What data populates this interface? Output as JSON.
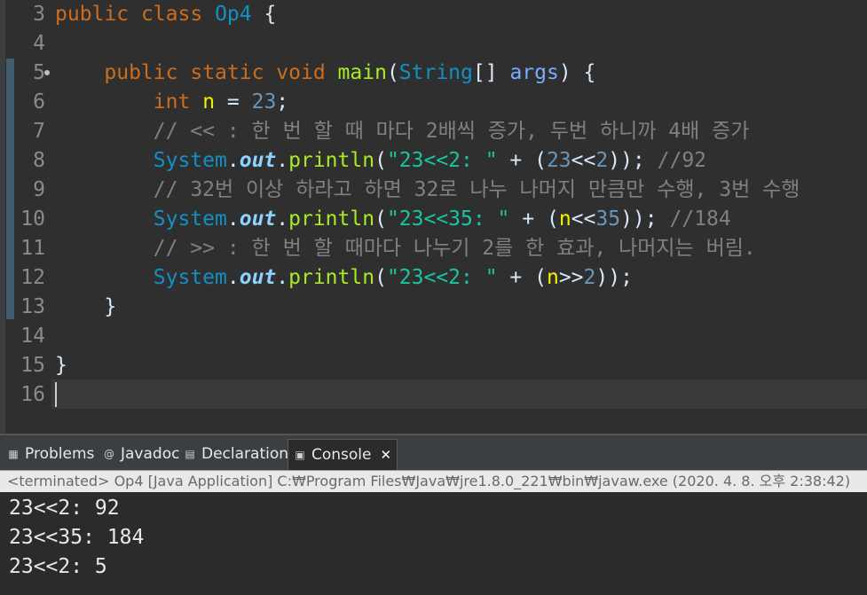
{
  "editor": {
    "lines": [
      {
        "n": "3",
        "segs": [
          [
            "kw",
            "public"
          ],
          [
            "p",
            " "
          ],
          [
            "kw",
            "class"
          ],
          [
            "p",
            " "
          ],
          [
            "ty",
            "Op4"
          ],
          [
            "p",
            " {"
          ]
        ]
      },
      {
        "n": "4",
        "segs": []
      },
      {
        "n": "5",
        "segs": [
          [
            "p",
            "    "
          ],
          [
            "kw",
            "public"
          ],
          [
            "p",
            " "
          ],
          [
            "kw",
            "static"
          ],
          [
            "p",
            " "
          ],
          [
            "kw",
            "void"
          ],
          [
            "p",
            " "
          ],
          [
            "fn",
            "main"
          ],
          [
            "p",
            "("
          ],
          [
            "ty",
            "String"
          ],
          [
            "p",
            "[] "
          ],
          [
            "va",
            "args"
          ],
          [
            "p",
            ") {"
          ]
        ]
      },
      {
        "n": "6",
        "segs": [
          [
            "p",
            "        "
          ],
          [
            "kw",
            "int"
          ],
          [
            "p",
            " "
          ],
          [
            "fl",
            "n"
          ],
          [
            "p",
            " = "
          ],
          [
            "nu",
            "23"
          ],
          [
            "p",
            ";"
          ]
        ]
      },
      {
        "n": "7",
        "segs": [
          [
            "p",
            "        "
          ],
          [
            "cm",
            "// << : 한 번 할 때 마다 2배씩 증가, 두번 하니까 4배 증가"
          ]
        ]
      },
      {
        "n": "8",
        "segs": [
          [
            "p",
            "        "
          ],
          [
            "ty",
            "System"
          ],
          [
            "p",
            "."
          ],
          [
            "sf",
            "out"
          ],
          [
            "p",
            "."
          ],
          [
            "fn",
            "println"
          ],
          [
            "p",
            "("
          ],
          [
            "st",
            "\"23<<2: \""
          ],
          [
            "p",
            " + ("
          ],
          [
            "nu",
            "23"
          ],
          [
            "p",
            "<<"
          ],
          [
            "nu",
            "2"
          ],
          [
            "p",
            "));"
          ],
          [
            "p",
            " "
          ],
          [
            "cm",
            "//92"
          ]
        ]
      },
      {
        "n": "9",
        "segs": [
          [
            "p",
            "        "
          ],
          [
            "cm",
            "// 32번 이상 하라고 하면 32로 나누 나머지 만큼만 수행, 3번 수행"
          ]
        ]
      },
      {
        "n": "10",
        "segs": [
          [
            "p",
            "        "
          ],
          [
            "ty",
            "System"
          ],
          [
            "p",
            "."
          ],
          [
            "sf",
            "out"
          ],
          [
            "p",
            "."
          ],
          [
            "fn",
            "println"
          ],
          [
            "p",
            "("
          ],
          [
            "st",
            "\"23<<35: \""
          ],
          [
            "p",
            " + ("
          ],
          [
            "fl",
            "n"
          ],
          [
            "p",
            "<<"
          ],
          [
            "nu",
            "35"
          ],
          [
            "p",
            "));"
          ],
          [
            "p",
            " "
          ],
          [
            "cm",
            "//184"
          ]
        ]
      },
      {
        "n": "11",
        "segs": [
          [
            "p",
            "        "
          ],
          [
            "cm",
            "// >> : 한 번 할 때마다 나누기 2를 한 효과, 나머지는 버림."
          ]
        ]
      },
      {
        "n": "12",
        "segs": [
          [
            "p",
            "        "
          ],
          [
            "ty",
            "System"
          ],
          [
            "p",
            "."
          ],
          [
            "sf",
            "out"
          ],
          [
            "p",
            "."
          ],
          [
            "fn",
            "println"
          ],
          [
            "p",
            "("
          ],
          [
            "st",
            "\"23<<2: \""
          ],
          [
            "p",
            " + ("
          ],
          [
            "fl",
            "n"
          ],
          [
            "p",
            ">>"
          ],
          [
            "nu",
            "2"
          ],
          [
            "p",
            "));"
          ]
        ]
      },
      {
        "n": "13",
        "segs": [
          [
            "p",
            "    }"
          ]
        ]
      },
      {
        "n": "14",
        "segs": []
      },
      {
        "n": "15",
        "segs": [
          [
            "p",
            "}"
          ]
        ]
      },
      {
        "n": "16",
        "segs": []
      }
    ]
  },
  "tabs": {
    "problems": "Problems",
    "javadoc": "Javadoc",
    "declaration": "Declaration",
    "console": "Console",
    "close": "✕"
  },
  "console": {
    "header": "<terminated> Op4 [Java Application] C:₩Program Files₩Java₩jre1.8.0_221₩bin₩javaw.exe (2020. 4. 8. 오후 2:38:42)",
    "output": [
      "23<<2: 92",
      "23<<35: 184",
      "23<<2: 5"
    ]
  },
  "colors": {
    "keyword": "#cc6c1d",
    "type": "#1290c3",
    "method": "#a7ec21",
    "string": "#17c6a3",
    "number": "#6897bb",
    "comment": "#808080"
  }
}
